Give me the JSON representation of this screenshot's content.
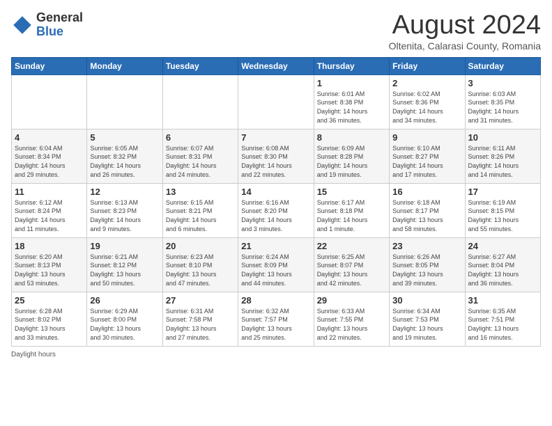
{
  "header": {
    "logo_general": "General",
    "logo_blue": "Blue",
    "month_title": "August 2024",
    "location": "Oltenita, Calarasi County, Romania"
  },
  "days_of_week": [
    "Sunday",
    "Monday",
    "Tuesday",
    "Wednesday",
    "Thursday",
    "Friday",
    "Saturday"
  ],
  "weeks": [
    [
      {
        "day": "",
        "info": ""
      },
      {
        "day": "",
        "info": ""
      },
      {
        "day": "",
        "info": ""
      },
      {
        "day": "",
        "info": ""
      },
      {
        "day": "1",
        "info": "Sunrise: 6:01 AM\nSunset: 8:38 PM\nDaylight: 14 hours\nand 36 minutes."
      },
      {
        "day": "2",
        "info": "Sunrise: 6:02 AM\nSunset: 8:36 PM\nDaylight: 14 hours\nand 34 minutes."
      },
      {
        "day": "3",
        "info": "Sunrise: 6:03 AM\nSunset: 8:35 PM\nDaylight: 14 hours\nand 31 minutes."
      }
    ],
    [
      {
        "day": "4",
        "info": "Sunrise: 6:04 AM\nSunset: 8:34 PM\nDaylight: 14 hours\nand 29 minutes."
      },
      {
        "day": "5",
        "info": "Sunrise: 6:05 AM\nSunset: 8:32 PM\nDaylight: 14 hours\nand 26 minutes."
      },
      {
        "day": "6",
        "info": "Sunrise: 6:07 AM\nSunset: 8:31 PM\nDaylight: 14 hours\nand 24 minutes."
      },
      {
        "day": "7",
        "info": "Sunrise: 6:08 AM\nSunset: 8:30 PM\nDaylight: 14 hours\nand 22 minutes."
      },
      {
        "day": "8",
        "info": "Sunrise: 6:09 AM\nSunset: 8:28 PM\nDaylight: 14 hours\nand 19 minutes."
      },
      {
        "day": "9",
        "info": "Sunrise: 6:10 AM\nSunset: 8:27 PM\nDaylight: 14 hours\nand 17 minutes."
      },
      {
        "day": "10",
        "info": "Sunrise: 6:11 AM\nSunset: 8:26 PM\nDaylight: 14 hours\nand 14 minutes."
      }
    ],
    [
      {
        "day": "11",
        "info": "Sunrise: 6:12 AM\nSunset: 8:24 PM\nDaylight: 14 hours\nand 11 minutes."
      },
      {
        "day": "12",
        "info": "Sunrise: 6:13 AM\nSunset: 8:23 PM\nDaylight: 14 hours\nand 9 minutes."
      },
      {
        "day": "13",
        "info": "Sunrise: 6:15 AM\nSunset: 8:21 PM\nDaylight: 14 hours\nand 6 minutes."
      },
      {
        "day": "14",
        "info": "Sunrise: 6:16 AM\nSunset: 8:20 PM\nDaylight: 14 hours\nand 3 minutes."
      },
      {
        "day": "15",
        "info": "Sunrise: 6:17 AM\nSunset: 8:18 PM\nDaylight: 14 hours\nand 1 minute."
      },
      {
        "day": "16",
        "info": "Sunrise: 6:18 AM\nSunset: 8:17 PM\nDaylight: 13 hours\nand 58 minutes."
      },
      {
        "day": "17",
        "info": "Sunrise: 6:19 AM\nSunset: 8:15 PM\nDaylight: 13 hours\nand 55 minutes."
      }
    ],
    [
      {
        "day": "18",
        "info": "Sunrise: 6:20 AM\nSunset: 8:13 PM\nDaylight: 13 hours\nand 53 minutes."
      },
      {
        "day": "19",
        "info": "Sunrise: 6:21 AM\nSunset: 8:12 PM\nDaylight: 13 hours\nand 50 minutes."
      },
      {
        "day": "20",
        "info": "Sunrise: 6:23 AM\nSunset: 8:10 PM\nDaylight: 13 hours\nand 47 minutes."
      },
      {
        "day": "21",
        "info": "Sunrise: 6:24 AM\nSunset: 8:09 PM\nDaylight: 13 hours\nand 44 minutes."
      },
      {
        "day": "22",
        "info": "Sunrise: 6:25 AM\nSunset: 8:07 PM\nDaylight: 13 hours\nand 42 minutes."
      },
      {
        "day": "23",
        "info": "Sunrise: 6:26 AM\nSunset: 8:05 PM\nDaylight: 13 hours\nand 39 minutes."
      },
      {
        "day": "24",
        "info": "Sunrise: 6:27 AM\nSunset: 8:04 PM\nDaylight: 13 hours\nand 36 minutes."
      }
    ],
    [
      {
        "day": "25",
        "info": "Sunrise: 6:28 AM\nSunset: 8:02 PM\nDaylight: 13 hours\nand 33 minutes."
      },
      {
        "day": "26",
        "info": "Sunrise: 6:29 AM\nSunset: 8:00 PM\nDaylight: 13 hours\nand 30 minutes."
      },
      {
        "day": "27",
        "info": "Sunrise: 6:31 AM\nSunset: 7:58 PM\nDaylight: 13 hours\nand 27 minutes."
      },
      {
        "day": "28",
        "info": "Sunrise: 6:32 AM\nSunset: 7:57 PM\nDaylight: 13 hours\nand 25 minutes."
      },
      {
        "day": "29",
        "info": "Sunrise: 6:33 AM\nSunset: 7:55 PM\nDaylight: 13 hours\nand 22 minutes."
      },
      {
        "day": "30",
        "info": "Sunrise: 6:34 AM\nSunset: 7:53 PM\nDaylight: 13 hours\nand 19 minutes."
      },
      {
        "day": "31",
        "info": "Sunrise: 6:35 AM\nSunset: 7:51 PM\nDaylight: 13 hours\nand 16 minutes."
      }
    ]
  ],
  "footer": {
    "daylight_label": "Daylight hours"
  }
}
